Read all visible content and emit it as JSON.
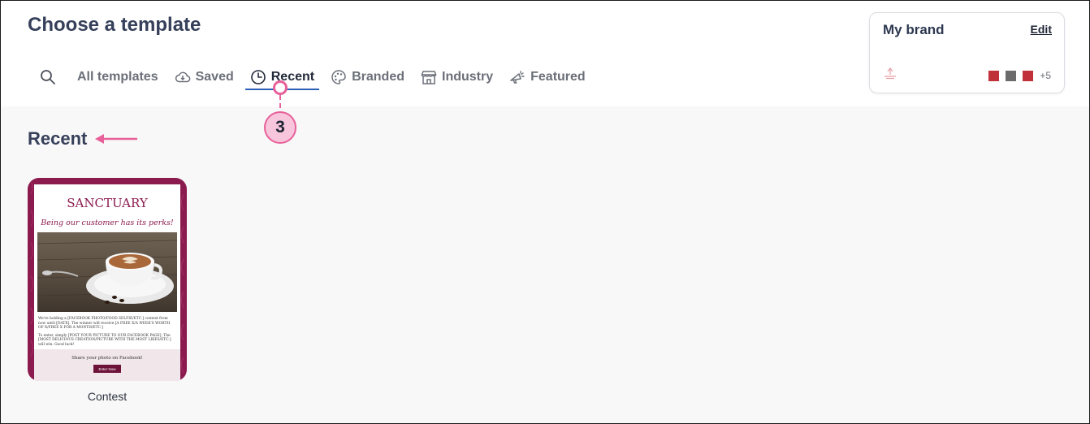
{
  "header": {
    "title": "Choose a template"
  },
  "tabs": [
    {
      "id": "search",
      "label": "",
      "icon": "search-icon"
    },
    {
      "id": "all",
      "label": "All templates",
      "icon": ""
    },
    {
      "id": "saved",
      "label": "Saved",
      "icon": "cloud-download-icon"
    },
    {
      "id": "recent",
      "label": "Recent",
      "icon": "clock-icon",
      "active": true
    },
    {
      "id": "branded",
      "label": "Branded",
      "icon": "palette-icon"
    },
    {
      "id": "industry",
      "label": "Industry",
      "icon": "storefront-icon"
    },
    {
      "id": "featured",
      "label": "Featured",
      "icon": "megaphone-icon"
    }
  ],
  "brand": {
    "title": "My brand",
    "edit_label": "Edit",
    "swatch_colors": [
      "#c0313a",
      "#6b6b6b",
      "#c0313a"
    ],
    "more_label": "+5"
  },
  "callout": {
    "number": "3",
    "color": "#e8609a"
  },
  "section": {
    "title": "Recent"
  },
  "templates": [
    {
      "name": "Contest",
      "preview": {
        "logo": "SANCTUARY",
        "tagline": "Being our customer has its perks!",
        "paragraph_1": "We're holding a [FACEBOOK PHOTO/FOOD SELFIE/ETC.] contest from now until [DATE]. The winner will receive [A FREE X/A WEEK'S WORTH OF X/FREE X FOR A MONTH/ETC.]",
        "paragraph_2": "To enter, simply [POST YOUR PICTURE TO OUR FACEBOOK PAGE]. The [MOST DELICIOUS CREATION/PICTURE WITH THE MOST LIKES/ETC.] will win. Good luck!",
        "footer_text": "Share your photo on Facebook!",
        "button_label": "Enter Now",
        "accent_color": "#8b1a4e"
      }
    }
  ]
}
